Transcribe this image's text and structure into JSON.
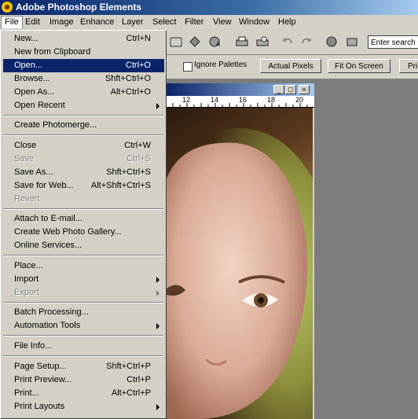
{
  "app": {
    "title": "Adobe Photoshop Elements"
  },
  "menubar": [
    "File",
    "Edit",
    "Image",
    "Enhance",
    "Layer",
    "Select",
    "Filter",
    "View",
    "Window",
    "Help"
  ],
  "search": {
    "placeholder": "Enter search c"
  },
  "options": {
    "ignore_palettes": "Ignore Palettes",
    "actual_pixels": "Actual Pixels",
    "fit_on_screen": "Fit On Screen",
    "print_size": "Pri"
  },
  "ruler": {
    "ticks": [
      "12",
      "14",
      "16",
      "18",
      "20"
    ]
  },
  "file_menu": {
    "groups": [
      [
        {
          "label": "New...",
          "shortcut": "Ctrl+N"
        },
        {
          "label": "New from Clipboard",
          "shortcut": ""
        },
        {
          "label": "Open...",
          "shortcut": "Ctrl+O",
          "selected": true
        },
        {
          "label": "Browse...",
          "shortcut": "Shft+Ctrl+O"
        },
        {
          "label": "Open As...",
          "shortcut": "Alt+Ctrl+O"
        },
        {
          "label": "Open Recent",
          "shortcut": "",
          "submenu": true
        }
      ],
      [
        {
          "label": "Create Photomerge...",
          "shortcut": ""
        }
      ],
      [
        {
          "label": "Close",
          "shortcut": "Ctrl+W"
        },
        {
          "label": "Save",
          "shortcut": "Ctrl+S",
          "disabled": true
        },
        {
          "label": "Save As...",
          "shortcut": "Shft+Ctrl+S"
        },
        {
          "label": "Save for Web...",
          "shortcut": "Alt+Shft+Ctrl+S"
        },
        {
          "label": "Revert",
          "shortcut": "",
          "disabled": true
        }
      ],
      [
        {
          "label": "Attach to E-mail...",
          "shortcut": ""
        },
        {
          "label": "Create Web Photo Gallery...",
          "shortcut": ""
        },
        {
          "label": "Online Services...",
          "shortcut": ""
        }
      ],
      [
        {
          "label": "Place...",
          "shortcut": ""
        },
        {
          "label": "Import",
          "shortcut": "",
          "submenu": true
        },
        {
          "label": "Export",
          "shortcut": "",
          "submenu": true,
          "disabled": true
        }
      ],
      [
        {
          "label": "Batch Processing...",
          "shortcut": ""
        },
        {
          "label": "Automation Tools",
          "shortcut": "",
          "submenu": true
        }
      ],
      [
        {
          "label": "File Info...",
          "shortcut": ""
        }
      ],
      [
        {
          "label": "Page Setup...",
          "shortcut": "Shft+Ctrl+P"
        },
        {
          "label": "Print Preview...",
          "shortcut": "Ctrl+P"
        },
        {
          "label": "Print...",
          "shortcut": "Alt+Ctrl+P"
        },
        {
          "label": "Print Layouts",
          "shortcut": "",
          "submenu": true
        }
      ]
    ]
  }
}
